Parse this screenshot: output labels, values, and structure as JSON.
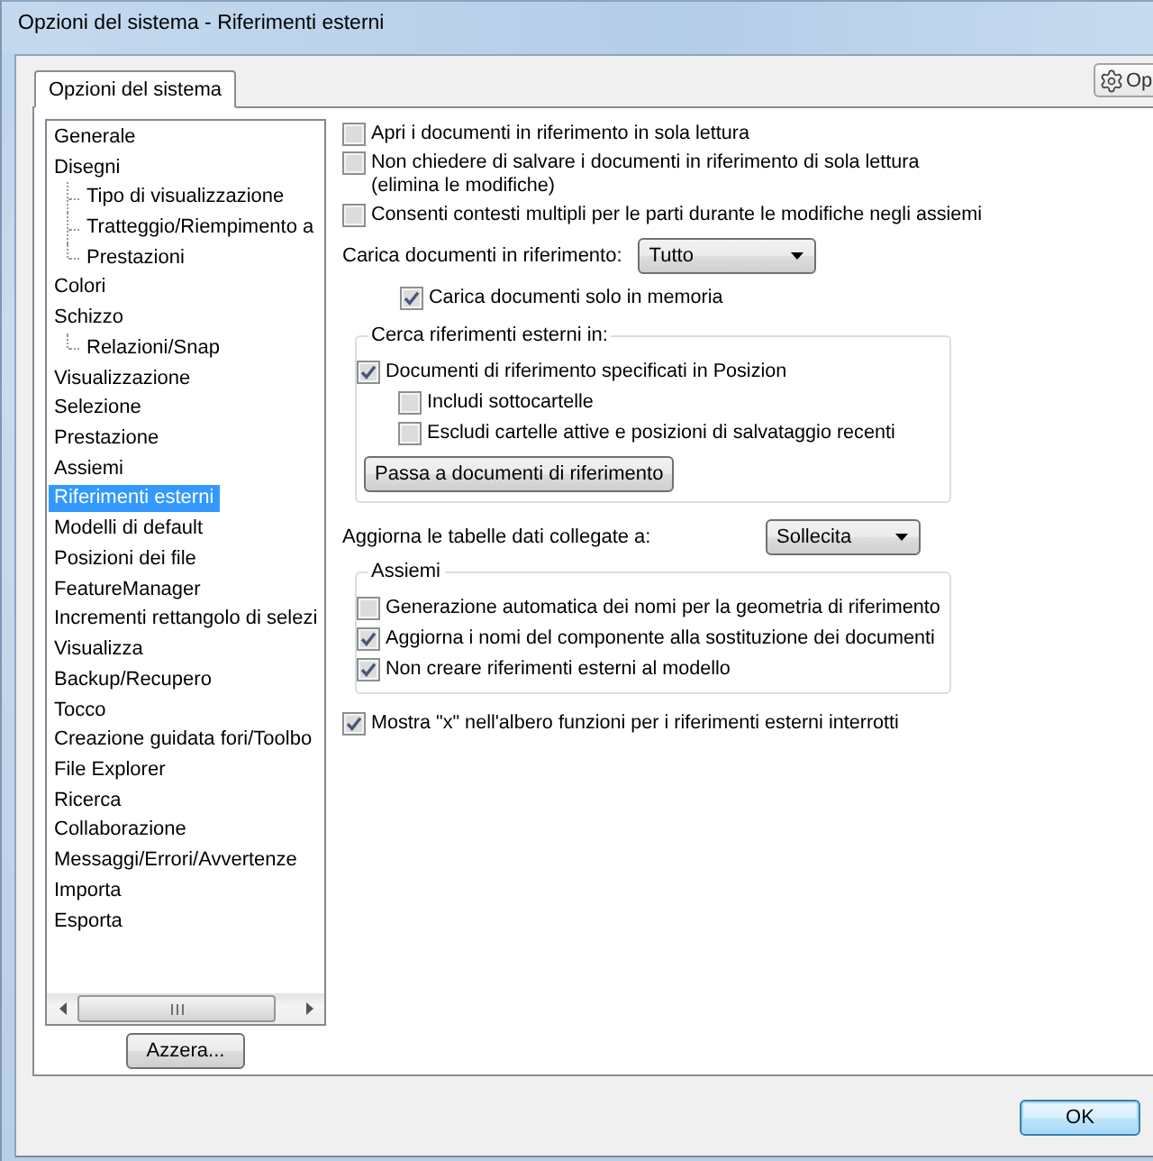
{
  "window": {
    "title": "Opzioni del sistema - Riferimenti esterni"
  },
  "tabs": [
    {
      "label": "Opzioni del sistema",
      "selected": true
    }
  ],
  "options_button": {
    "label": "Op"
  },
  "sidebar": {
    "items": [
      {
        "label": "Generale",
        "selected": false
      },
      {
        "label": "Disegni",
        "selected": false,
        "children": [
          {
            "label": "Tipo di visualizzazione",
            "selected": false
          },
          {
            "label": "Tratteggio/Riempimento a",
            "selected": false
          },
          {
            "label": "Prestazioni",
            "selected": false
          }
        ]
      },
      {
        "label": "Colori",
        "selected": false
      },
      {
        "label": "Schizzo",
        "selected": false,
        "children": [
          {
            "label": "Relazioni/Snap",
            "selected": false
          }
        ]
      },
      {
        "label": "Visualizzazione",
        "selected": false
      },
      {
        "label": "Selezione",
        "selected": false
      },
      {
        "label": "Prestazione",
        "selected": false
      },
      {
        "label": "Assiemi",
        "selected": false
      },
      {
        "label": "Riferimenti esterni",
        "selected": true
      },
      {
        "label": "Modelli di default",
        "selected": false
      },
      {
        "label": "Posizioni dei file",
        "selected": false
      },
      {
        "label": "FeatureManager",
        "selected": false
      },
      {
        "label": "Incrementi rettangolo di selezi",
        "selected": false
      },
      {
        "label": "Visualizza",
        "selected": false
      },
      {
        "label": "Backup/Recupero",
        "selected": false
      },
      {
        "label": "Tocco",
        "selected": false
      },
      {
        "label": "Creazione guidata fori/Toolbo",
        "selected": false
      },
      {
        "label": "File Explorer",
        "selected": false
      },
      {
        "label": "Ricerca",
        "selected": false
      },
      {
        "label": "Collaborazione",
        "selected": false
      },
      {
        "label": "Messaggi/Errori/Avvertenze",
        "selected": false
      },
      {
        "label": "Importa",
        "selected": false
      },
      {
        "label": "Esporta",
        "selected": false
      }
    ],
    "button": "Azzera..."
  },
  "settings": [
    {
      "kind": "checkbox",
      "label": "Apri i documenti in riferimento in sola lettura",
      "checked": false
    },
    {
      "kind": "checkbox",
      "label": "Non chiedere di salvare i documenti in riferimento di sola lettura\n(elimina le modifiche)",
      "checked": false
    },
    {
      "kind": "checkbox",
      "label": "Consenti contesti multipli per le parti durante le modifiche negli assiemi",
      "checked": false
    },
    {
      "kind": "dropdown",
      "label": "Carica documenti in riferimento:",
      "value": "Tutto",
      "children": [
        {
          "kind": "checkbox",
          "label": "Carica documenti solo in memoria",
          "checked": true
        }
      ]
    },
    {
      "kind": "group",
      "title": "Cerca riferimenti esterni in:",
      "items": [
        {
          "kind": "checkbox",
          "label": "Documenti di riferimento specificati in Posizion",
          "checked": true,
          "children": [
            {
              "kind": "checkbox",
              "label": "Includi sottocartelle",
              "checked": false
            },
            {
              "kind": "checkbox",
              "label": "Escludi cartelle attive e posizioni di salvataggio recenti",
              "checked": false
            }
          ]
        },
        {
          "kind": "button",
          "label": "Passa a documenti di riferimento"
        }
      ]
    },
    {
      "kind": "dropdown",
      "label": "Aggiorna le tabelle dati collegate a:",
      "value": "Sollecita"
    },
    {
      "kind": "group",
      "title": "Assiemi",
      "items": [
        {
          "kind": "checkbox",
          "label": "Generazione automatica dei nomi per la geometria di riferimento",
          "checked": false
        },
        {
          "kind": "checkbox",
          "label": "Aggiorna i nomi del componente alla sostituzione dei documenti",
          "checked": true
        },
        {
          "kind": "checkbox",
          "label": "Non creare riferimenti esterni al modello",
          "checked": true
        }
      ]
    },
    {
      "kind": "checkbox",
      "label": "Mostra \"x\" nell'albero funzioni per i riferimenti esterni interrotti",
      "checked": true
    }
  ],
  "buttons": [
    "OK"
  ]
}
